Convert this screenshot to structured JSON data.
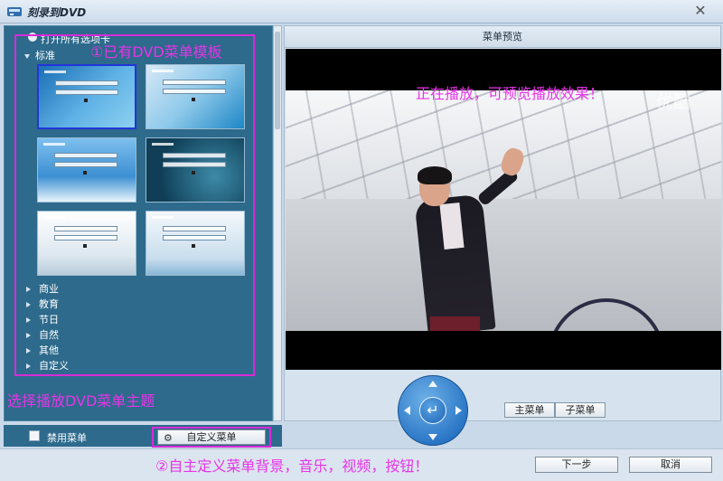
{
  "window": {
    "title": "刻录到DVD",
    "close_glyph": "✕"
  },
  "left_panel": {
    "open_all_label": "打开所有选项卡",
    "standard_label": "标准",
    "categories": [
      "商业",
      "教育",
      "节日",
      "自然",
      "其他",
      "自定义"
    ]
  },
  "annotations": {
    "template_note": "①已有DVD菜单模板",
    "select_theme_note": "选择播放DVD菜单主题",
    "custom_note": "②自主定义菜单背景，音乐，视频，按钮！",
    "playing_note": "正在播放，可预览播放效果！"
  },
  "bottom_left": {
    "disable_menu_label": "禁用菜单",
    "custom_menu_button": "自定义菜单"
  },
  "preview": {
    "header": "菜单预览",
    "watermark": "优酷"
  },
  "menu_buttons": {
    "main_menu": "主菜单",
    "sub_menu": "子菜单"
  },
  "footer": {
    "next_button": "下一步",
    "cancel_button": "取消"
  },
  "colors": {
    "accent_magenta": "#d82bd8",
    "panel_blue": "#2d6a8c",
    "selection_blue": "#2136d8"
  }
}
